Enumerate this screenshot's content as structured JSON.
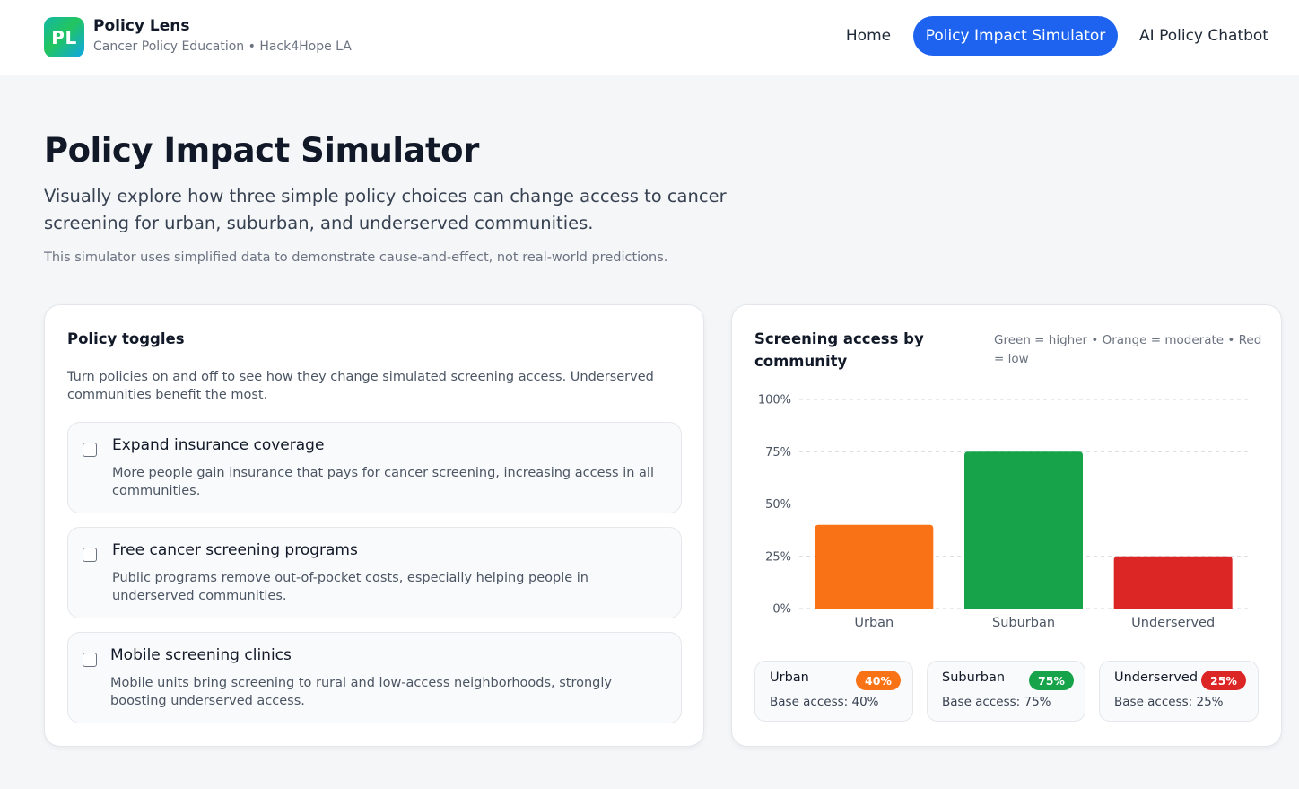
{
  "brand": {
    "logo_text": "PL",
    "name": "Policy Lens",
    "subtitle": "Cancer Policy Education • Hack4Hope LA"
  },
  "nav": {
    "home": "Home",
    "simulator": "Policy Impact Simulator",
    "chatbot": "AI Policy Chatbot",
    "active": "Policy Impact Simulator"
  },
  "page": {
    "title": "Policy Impact Simulator",
    "lead": "Visually explore how three simple policy choices can change access to cancer screening for urban, suburban, and underserved communities.",
    "note": "This simulator uses simplified data to demonstrate cause-and-effect, not real-world predictions."
  },
  "toggles": {
    "title": "Policy toggles",
    "description": "Turn policies on and off to see how they change simulated screening access. Underserved communities benefit the most.",
    "items": [
      {
        "title": "Expand insurance coverage",
        "description": "More people gain insurance that pays for cancer screening, increasing access in all communities.",
        "checked": false
      },
      {
        "title": "Free cancer screening programs",
        "description": "Public programs remove out-of-pocket costs, especially helping people in underserved communities.",
        "checked": false
      },
      {
        "title": "Mobile screening clinics",
        "description": "Mobile units bring screening to rural and low-access neighborhoods, strongly boosting underserved access.",
        "checked": false
      }
    ]
  },
  "chart_panel": {
    "title": "Screening access by community",
    "legend": "Green = higher • Orange = moderate • Red = low"
  },
  "colors": {
    "high": "#16a34a",
    "moderate": "#f97316",
    "low": "#dc2626",
    "primary": "#1d63f0"
  },
  "chart_data": {
    "type": "bar",
    "categories": [
      "Urban",
      "Suburban",
      "Underserved"
    ],
    "values": [
      40,
      75,
      25
    ],
    "bar_colors": [
      "#f97316",
      "#16a34a",
      "#dc2626"
    ],
    "yticks": [
      "0%",
      "25%",
      "50%",
      "75%",
      "100%"
    ],
    "ylim": [
      0,
      100
    ],
    "grid": true,
    "title": "",
    "xlabel": "",
    "ylabel": ""
  },
  "stats": {
    "urban": {
      "name": "Urban",
      "badge": "40%",
      "base": "Base access: 40%"
    },
    "suburban": {
      "name": "Suburban",
      "badge": "75%",
      "base": "Base access: 75%"
    },
    "underserved": {
      "name": "Underserved",
      "badge": "25%",
      "base": "Base access: 25%"
    }
  }
}
